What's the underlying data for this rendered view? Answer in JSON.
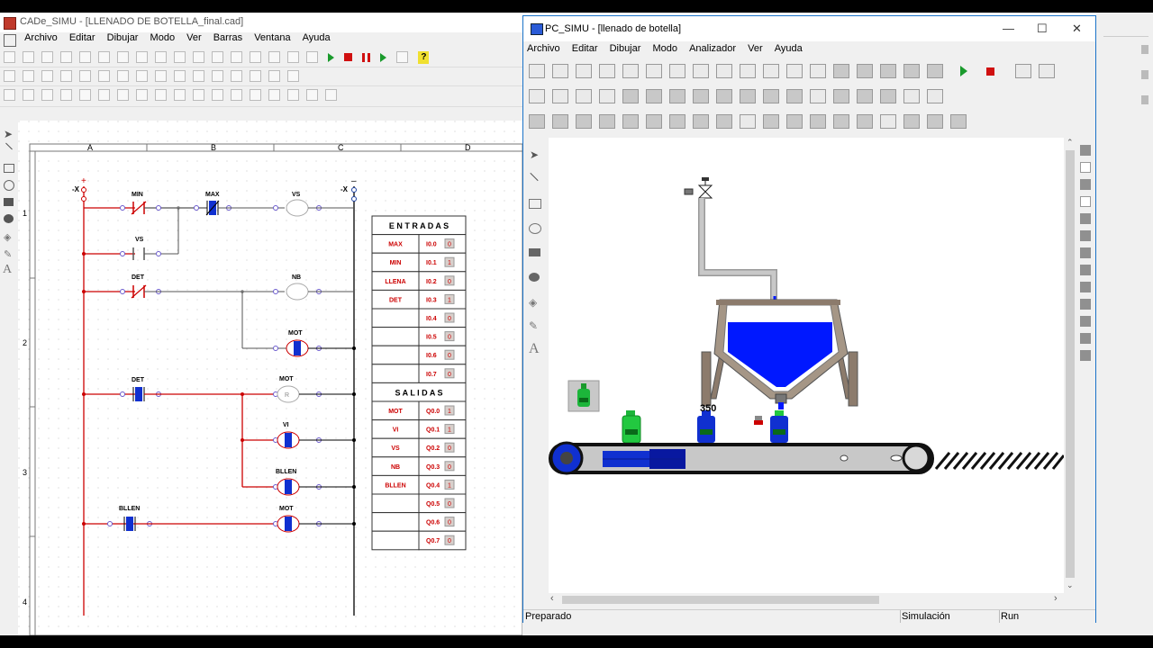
{
  "cade": {
    "title": "CADe_SIMU - [LLENADO DE BOTELLA_final.cad]",
    "menu": [
      "Archivo",
      "Editar",
      "Dibujar",
      "Modo",
      "Ver",
      "Barras",
      "Ventana",
      "Ayuda"
    ],
    "columns": [
      "A",
      "B",
      "C",
      "D"
    ],
    "rows": [
      "1",
      "2",
      "3",
      "4"
    ],
    "rung_labels": {
      "min": "MIN",
      "max": "MAX",
      "vs_coil": "VS",
      "vs_contact": "VS",
      "det1": "DET",
      "nb": "NB",
      "mot1": "MOT",
      "det2": "DET",
      "mot2": "MOT",
      "vl": "VI",
      "bllen_coil": "BLLEN",
      "bllen_contact": "BLLEN",
      "mot3": "MOT",
      "rail_left": "-X",
      "rail_right": "-X",
      "reset_symbol": "R"
    },
    "entradas": {
      "title": "E N T R A D A S",
      "rows": [
        {
          "label": "MAX",
          "addr": "I0.0",
          "val": "0"
        },
        {
          "label": "MIN",
          "addr": "I0.1",
          "val": "1"
        },
        {
          "label": "LLENA",
          "addr": "I0.2",
          "val": "0"
        },
        {
          "label": "DET",
          "addr": "I0.3",
          "val": "1"
        },
        {
          "label": "",
          "addr": "I0.4",
          "val": "0"
        },
        {
          "label": "",
          "addr": "I0.5",
          "val": "0"
        },
        {
          "label": "",
          "addr": "I0.6",
          "val": "0"
        },
        {
          "label": "",
          "addr": "I0.7",
          "val": "0"
        }
      ]
    },
    "salidas": {
      "title": "S A L I D A S",
      "rows": [
        {
          "label": "MOT",
          "addr": "Q0.0",
          "val": "1"
        },
        {
          "label": "VI",
          "addr": "Q0.1",
          "val": "1"
        },
        {
          "label": "VS",
          "addr": "Q0.2",
          "val": "0"
        },
        {
          "label": "NB",
          "addr": "Q0.3",
          "val": "0"
        },
        {
          "label": "BLLEN",
          "addr": "Q0.4",
          "val": "1"
        },
        {
          "label": "",
          "addr": "Q0.5",
          "val": "0"
        },
        {
          "label": "",
          "addr": "Q0.6",
          "val": "0"
        },
        {
          "label": "",
          "addr": "Q0.7",
          "val": "0"
        }
      ]
    }
  },
  "pcsimu": {
    "title": "PC_SIMU - [llenado de botella]",
    "menu": [
      "Archivo",
      "Editar",
      "Dibujar",
      "Modo",
      "Analizador",
      "Ver",
      "Ayuda"
    ],
    "counter": "350",
    "status": {
      "left": "Preparado",
      "mid": "Simulación",
      "right": "Run"
    }
  },
  "colors": {
    "accent_red": "#cc0000",
    "blue": "#0018ff",
    "wire": "#000000",
    "run_green": "#1a9a2c"
  }
}
